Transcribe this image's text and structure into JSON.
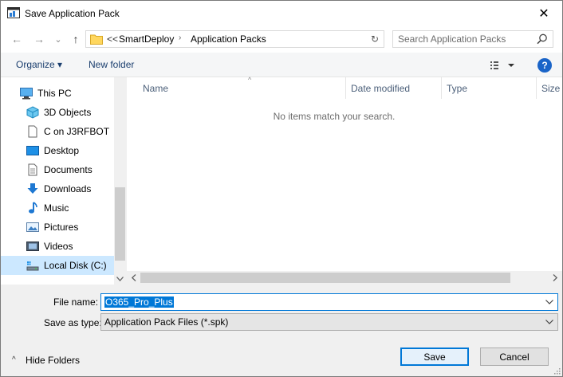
{
  "window": {
    "title": "Save Application Pack",
    "close_glyph": "✕"
  },
  "navigation": {
    "back_glyph": "←",
    "forward_glyph": "→",
    "recent_glyph": "⌄",
    "up_glyph": "↑",
    "overflow": "<<",
    "breadcrumb": [
      "SmartDeploy",
      "Application Packs"
    ],
    "separator": "›",
    "refresh_glyph": "↻"
  },
  "search": {
    "placeholder": "Search Application Packs"
  },
  "toolbar": {
    "organize_label": "Organize ▾",
    "new_folder_label": "New folder",
    "help_label": "?"
  },
  "sidebar": {
    "items": [
      {
        "label": "This PC",
        "icon": "computer-icon",
        "level": "root"
      },
      {
        "label": "3D Objects",
        "icon": "cube-icon",
        "level": "child"
      },
      {
        "label": "C on J3RFBOT",
        "icon": "document-icon",
        "level": "child"
      },
      {
        "label": "Desktop",
        "icon": "desktop-icon",
        "level": "child"
      },
      {
        "label": "Documents",
        "icon": "documents-icon",
        "level": "child"
      },
      {
        "label": "Downloads",
        "icon": "download-icon",
        "level": "child"
      },
      {
        "label": "Music",
        "icon": "music-icon",
        "level": "child"
      },
      {
        "label": "Pictures",
        "icon": "pictures-icon",
        "level": "child"
      },
      {
        "label": "Videos",
        "icon": "videos-icon",
        "level": "child"
      },
      {
        "label": "Local Disk (C:)",
        "icon": "drive-icon",
        "level": "child",
        "selected": true
      }
    ]
  },
  "filelist": {
    "columns": [
      "Name",
      "Date modified",
      "Type",
      "Size"
    ],
    "sort_glyph": "^",
    "empty_message": "No items match your search."
  },
  "form": {
    "file_name_label": "File name:",
    "file_name_value": "O365_Pro_Plus",
    "save_type_label": "Save as type:",
    "save_type_value": "Application Pack Files (*.spk)",
    "dropdown_glyph": "⌄"
  },
  "footer": {
    "hide_folders_glyph": "^",
    "hide_folders_label": "Hide Folders",
    "save_label": "Save",
    "cancel_label": "Cancel"
  },
  "colors": {
    "accent": "#0078d7",
    "selection": "#cce8ff",
    "help": "#1a64c8"
  }
}
